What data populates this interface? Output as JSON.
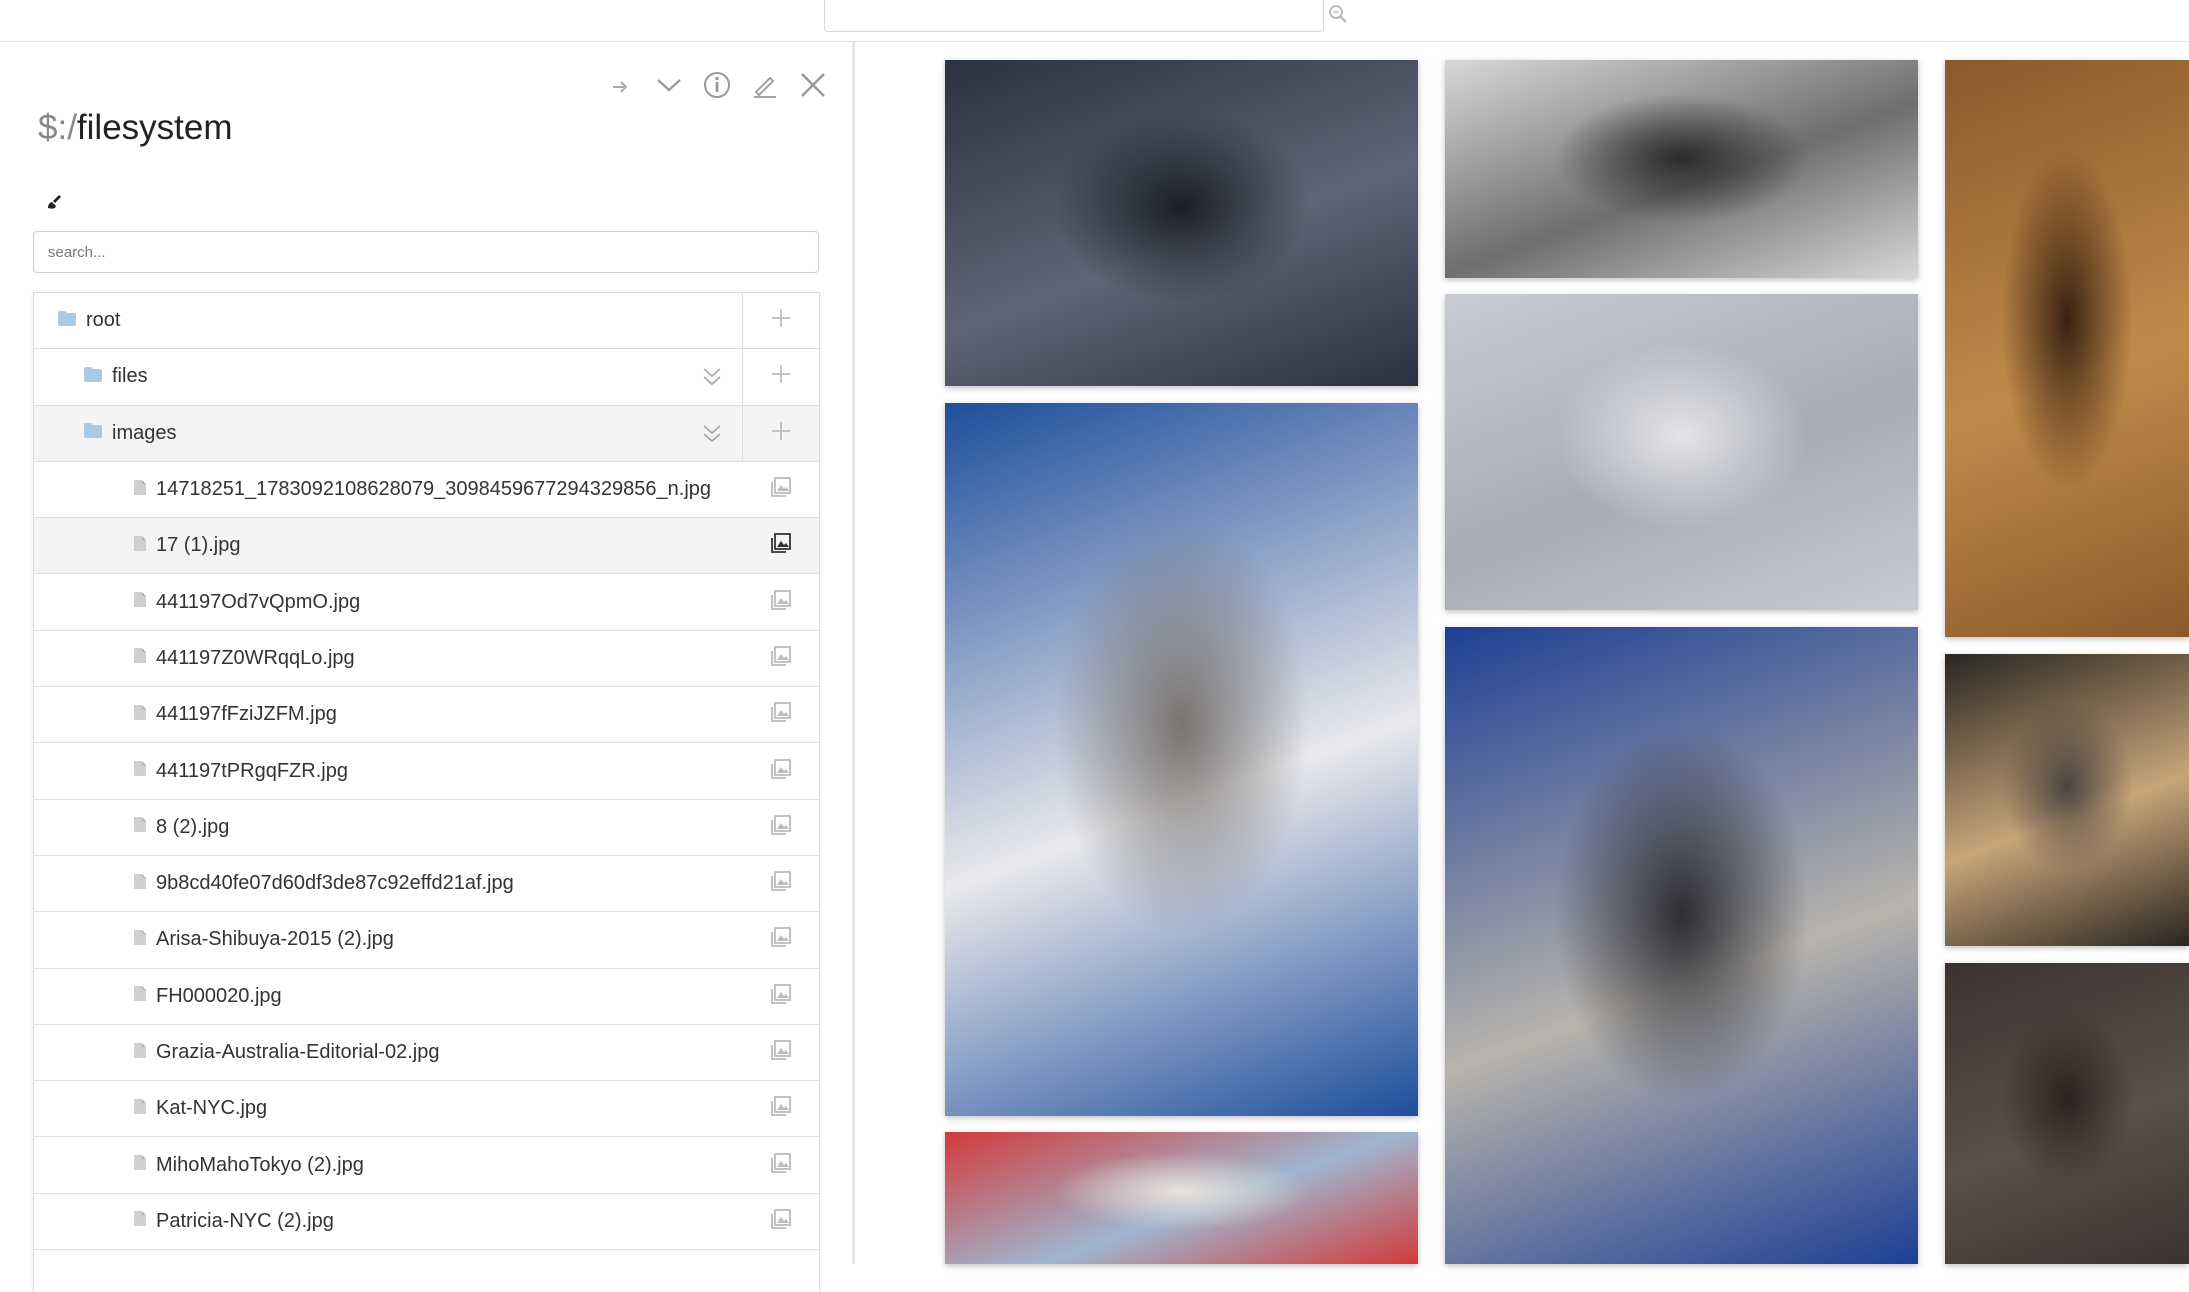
{
  "topbar": {
    "search_value": "",
    "search_icon": "search-icon"
  },
  "panel": {
    "title_prefix": "$:/",
    "title": "filesystem",
    "toolbar_icons": [
      "redo-icon",
      "chevron-down-icon",
      "info-icon",
      "edit-icon",
      "close-icon"
    ],
    "search_placeholder": "search..."
  },
  "tree": {
    "folders": [
      {
        "label": "root"
      },
      {
        "label": "files"
      },
      {
        "label": "images"
      }
    ],
    "files": [
      "14718251_1783092108628079_3098459677294329856_n.jpg",
      "17 (1).jpg",
      "441197Od7vQpmO.jpg",
      "441197Z0WRqqLo.jpg",
      "441197fFziJZFM.jpg",
      "441197tPRgqFZR.jpg",
      "8 (2).jpg",
      "9b8cd40fe07d60df3de87c92effd21af.jpg",
      "Arisa-Shibuya-2015 (2).jpg",
      "FH000020.jpg",
      "Grazia-Australia-Editorial-02.jpg",
      "Kat-NYC.jpg",
      "MihoMahoTokyo (2).jpg",
      "Patricia-NYC (2).jpg"
    ],
    "highlighted_file_index": 1
  },
  "gallery": {
    "photos": [
      {
        "name": "photo-street-newspaper-dress",
        "colors": [
          "#2a3140",
          "#5d6576",
          "#1b1f28"
        ]
      },
      {
        "name": "photo-bw-statue-pose",
        "colors": [
          "#d8d8d8",
          "#6e6e6e",
          "#2b2b2b"
        ]
      },
      {
        "name": "photo-desert-rock",
        "colors": [
          "#8a5a2c",
          "#c08a4a",
          "#3a2210"
        ]
      },
      {
        "name": "photo-pavement-red-dress",
        "colors": [
          "#c9cbd2",
          "#a9acb5",
          "#e3e4e8"
        ]
      },
      {
        "name": "photo-cathedral-steps",
        "colors": [
          "#1e4e9c",
          "#e9e9ec",
          "#7a7470"
        ]
      },
      {
        "name": "photo-curly-hair-balcony",
        "colors": [
          "#1d3f95",
          "#b8b4ad",
          "#2d2d32"
        ]
      },
      {
        "name": "photo-beach-legs",
        "colors": [
          "#2a2520",
          "#c8a57a",
          "#4d4540"
        ]
      },
      {
        "name": "photo-red-umbrella",
        "colors": [
          "#d23a3a",
          "#9fb6cf",
          "#e8e2dc"
        ]
      },
      {
        "name": "photo-dark-rock",
        "colors": [
          "#3a3330",
          "#5a504a",
          "#2a2420"
        ]
      }
    ]
  }
}
